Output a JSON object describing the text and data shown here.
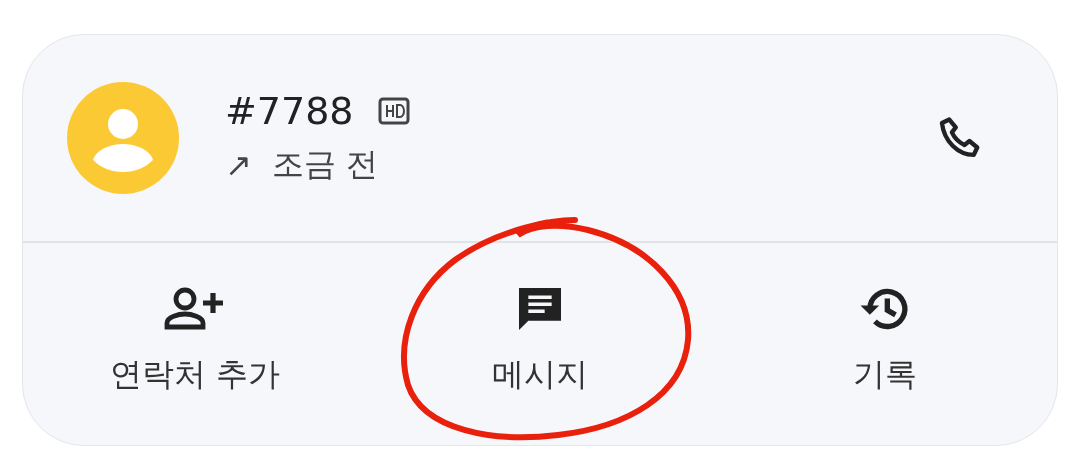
{
  "contact": {
    "name": "#7788",
    "hd": true,
    "direction": "↗",
    "time": "조금 전"
  },
  "actions": [
    {
      "kind": "add-contact",
      "label": "연락처 추가"
    },
    {
      "kind": "message",
      "label": "메시지"
    },
    {
      "kind": "history",
      "label": "기록"
    }
  ]
}
